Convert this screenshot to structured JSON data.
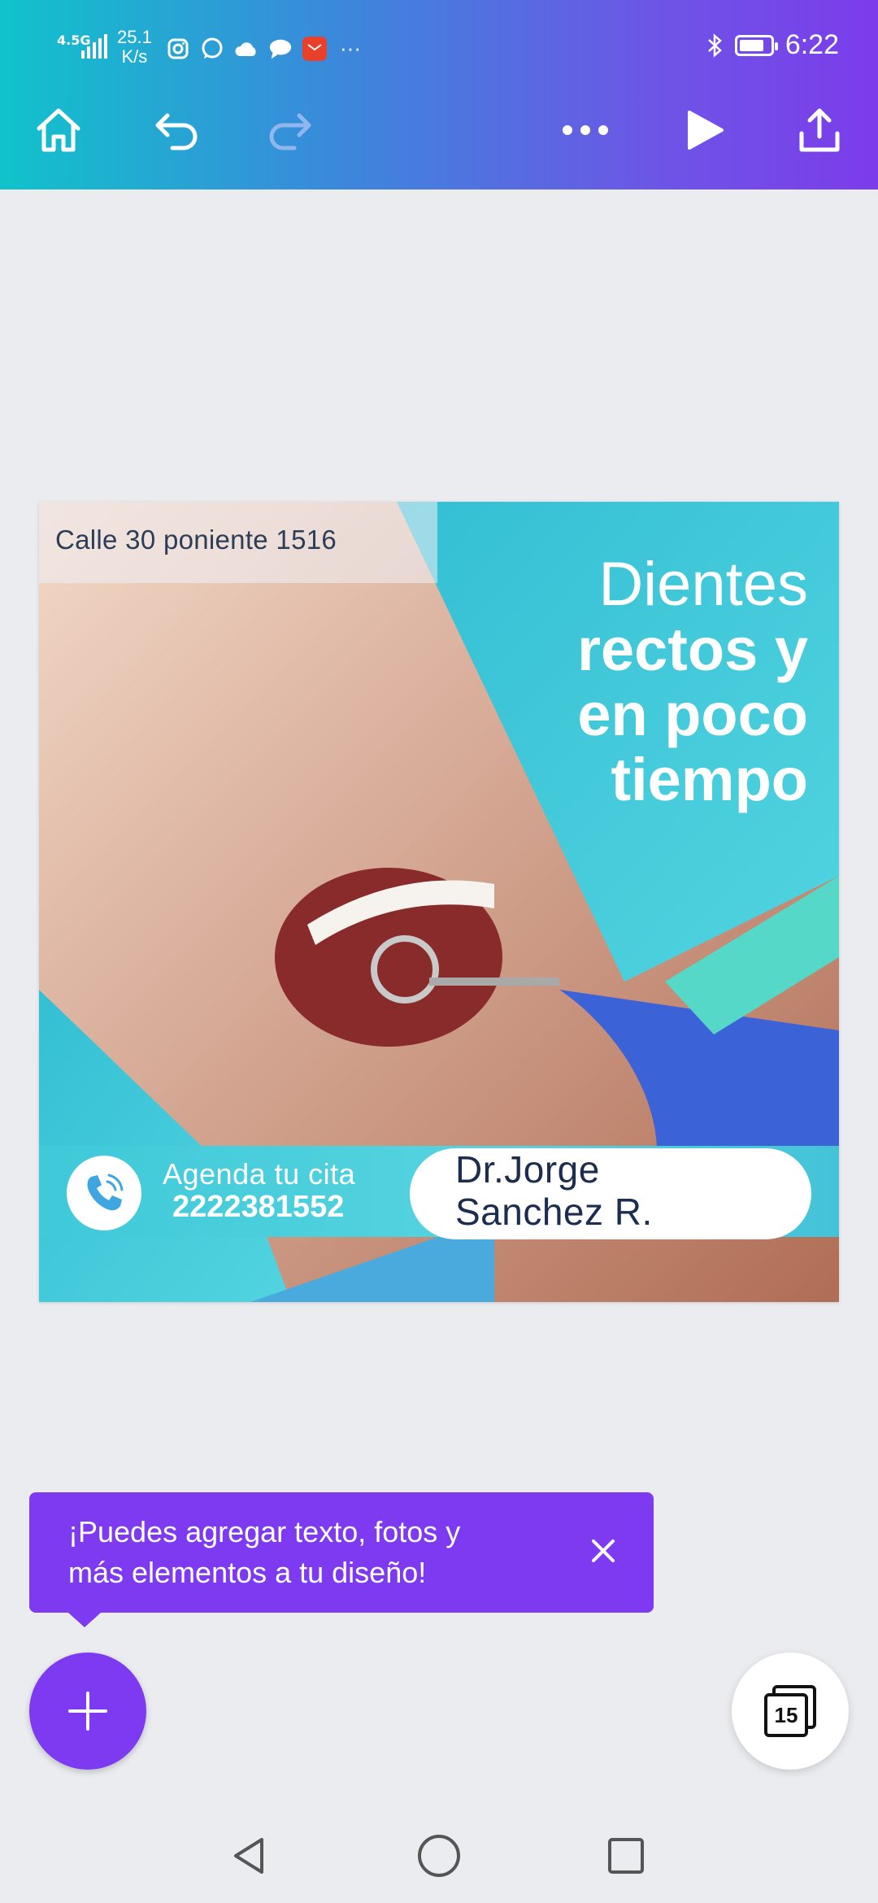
{
  "status_bar": {
    "network": "4.5G",
    "speed_value": "25.1",
    "speed_unit": "K/s",
    "more": "···",
    "time": "6:22",
    "battery_percent": 80
  },
  "toolbar": {
    "home_icon": "home-icon",
    "undo_icon": "undo-icon",
    "redo_icon": "redo-icon",
    "more_icon": "more-horizontal-icon",
    "play_icon": "play-icon",
    "share_icon": "share-icon",
    "accent": "#7c3cea"
  },
  "design": {
    "address": "Calle 30 poniente 1516",
    "headline_line1": "Dientes",
    "headline_line2": "rectos y",
    "headline_line3": "en poco",
    "headline_line4": "tiempo",
    "cta_label": "Agenda tu cita",
    "phone": "2222381552",
    "doctor_line1": "Dr.Jorge",
    "doctor_line2": "Sanchez R.",
    "accent_color": "#3fc9d9"
  },
  "tooltip": {
    "line1": "¡Puedes agregar texto, fotos y",
    "line2": "más elementos a tu diseño!",
    "close_icon": "close-icon",
    "color": "#7d3af0"
  },
  "fab": {
    "icon": "plus-icon"
  },
  "pages": {
    "count": "15"
  },
  "nav": {
    "back_icon": "back-triangle-icon",
    "home_icon": "home-circle-icon",
    "recents_icon": "recents-square-icon"
  }
}
